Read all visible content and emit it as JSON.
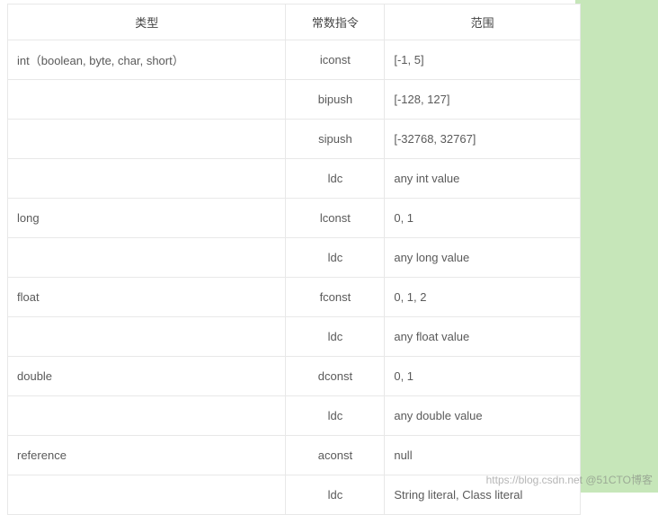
{
  "headers": {
    "type": "类型",
    "instruction": "常数指令",
    "range": "范围"
  },
  "rows": [
    {
      "type": "int（boolean, byte, char, short）",
      "instruction": "iconst",
      "range": "[-1, 5]"
    },
    {
      "type": "",
      "instruction": "bipush",
      "range": "[-128, 127]"
    },
    {
      "type": "",
      "instruction": "sipush",
      "range": "[-32768, 32767]"
    },
    {
      "type": "",
      "instruction": "ldc",
      "range": "any int value"
    },
    {
      "type": "long",
      "instruction": "lconst",
      "range": "0, 1"
    },
    {
      "type": "",
      "instruction": "ldc",
      "range": "any long value"
    },
    {
      "type": "float",
      "instruction": "fconst",
      "range": "0, 1, 2"
    },
    {
      "type": "",
      "instruction": "ldc",
      "range": "any float value"
    },
    {
      "type": "double",
      "instruction": "dconst",
      "range": "0, 1"
    },
    {
      "type": "",
      "instruction": "ldc",
      "range": "any double value"
    },
    {
      "type": "reference",
      "instruction": "aconst",
      "range": "null"
    },
    {
      "type": "",
      "instruction": "ldc",
      "range": "String literal, Class literal"
    }
  ],
  "watermark": "https://blog.csdn.net  @51CTO博客"
}
